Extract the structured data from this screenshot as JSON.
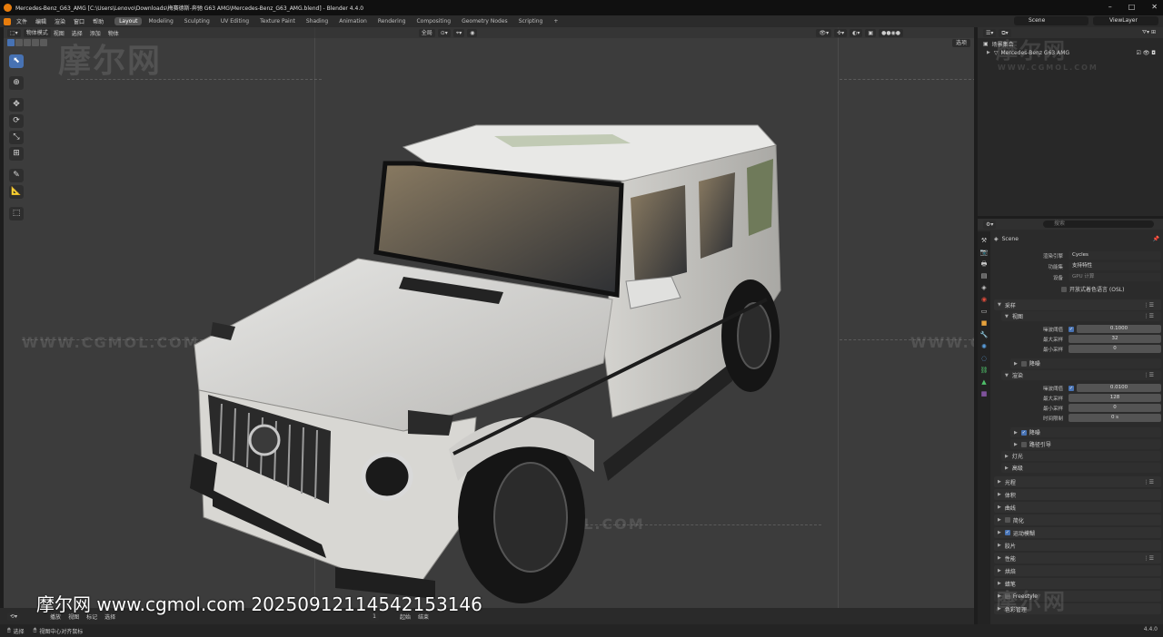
{
  "titlebar": {
    "title": "Mercedes-Benz_G63_AMG [C:\\Users\\Lenovo\\Downloads\\梅赛德斯-奔驰 G63 AMG\\Mercedes-Benz_G63_AMG.blend] - Blender 4.4.0",
    "minimize": "–",
    "maximize": "□",
    "close": "✕"
  },
  "menu": [
    "文件",
    "编辑",
    "渲染",
    "窗口",
    "帮助"
  ],
  "workspaces": [
    "Layout",
    "Modeling",
    "Sculpting",
    "UV Editing",
    "Texture Paint",
    "Shading",
    "Animation",
    "Rendering",
    "Compositing",
    "Geometry Nodes",
    "Scripting",
    "+"
  ],
  "active_workspace": "Layout",
  "scene_name": "Scene",
  "view_layer": "ViewLayer",
  "viewport": {
    "mode": "物体模式",
    "header_menus": [
      "视图",
      "选择",
      "添加",
      "物体"
    ],
    "orientation": "全局",
    "select_label": "选项",
    "tools": [
      "select-tool",
      "cursor-tool",
      "move-tool",
      "rotate-tool",
      "scale-tool",
      "transform-tool",
      "annotate-tool",
      "measure-tool",
      "add-cube-tool"
    ],
    "tool_glyphs": [
      "⬉",
      "⊕",
      "✥",
      "⟳",
      "⤡",
      "⊞",
      "✎",
      "📐",
      "⬚"
    ],
    "watermark_text": "WWW.CGMOL.COM",
    "watermark_cn": "摩尔网"
  },
  "viewport_bottom": {
    "items": [
      "播放",
      "视图",
      "标记",
      "选择"
    ],
    "frame": "1",
    "start_label": "起始",
    "end_label": "结束"
  },
  "stamp": "摩尔网 www.cgmol.com 20250912114542153146",
  "statusbar": {
    "left_select": "选择",
    "left_center": "视图中心对齐鼠标",
    "version": "4.4.0"
  },
  "outliner": {
    "collection": "场景集合",
    "object": "Mercedes-Benz G63 AMG"
  },
  "properties": {
    "search_placeholder": "搜索",
    "scene_label": "Scene",
    "render_engine_label": "渲染引擎",
    "render_engine": "Cycles",
    "feature_set_label": "功能集",
    "feature_set": "支持特性",
    "device_label": "设备",
    "device": "GPU 计算",
    "osl_label": "开放式着色语言 (OSL)",
    "sections": {
      "sampling": "采样",
      "viewport": "视图",
      "noise_threshold_label": "噪波阈值",
      "vp_noise_threshold": "0.1000",
      "max_samples_label": "最大采样",
      "vp_max_samples": "32",
      "min_samples_label": "最小采样",
      "vp_min_samples": "0",
      "denoise_vp": "降噪",
      "render": "渲染",
      "r_noise_threshold": "0.0100",
      "r_max_samples": "128",
      "r_min_samples": "0",
      "time_limit_label": "时间限制",
      "r_time_limit": "0 s",
      "denoise_r": "降噪",
      "path_guiding": "路径引导",
      "lights": "灯光",
      "advanced": "高级",
      "light_paths": "光程",
      "volumes": "体积",
      "curves": "曲线",
      "simplify": "简化",
      "motion_blur": "运动模糊",
      "film": "胶片",
      "performance": "性能",
      "bake": "烘焙",
      "grease_pencil": "蜡笔",
      "freestyle": "Freestyle",
      "color_management": "色彩管理"
    }
  }
}
